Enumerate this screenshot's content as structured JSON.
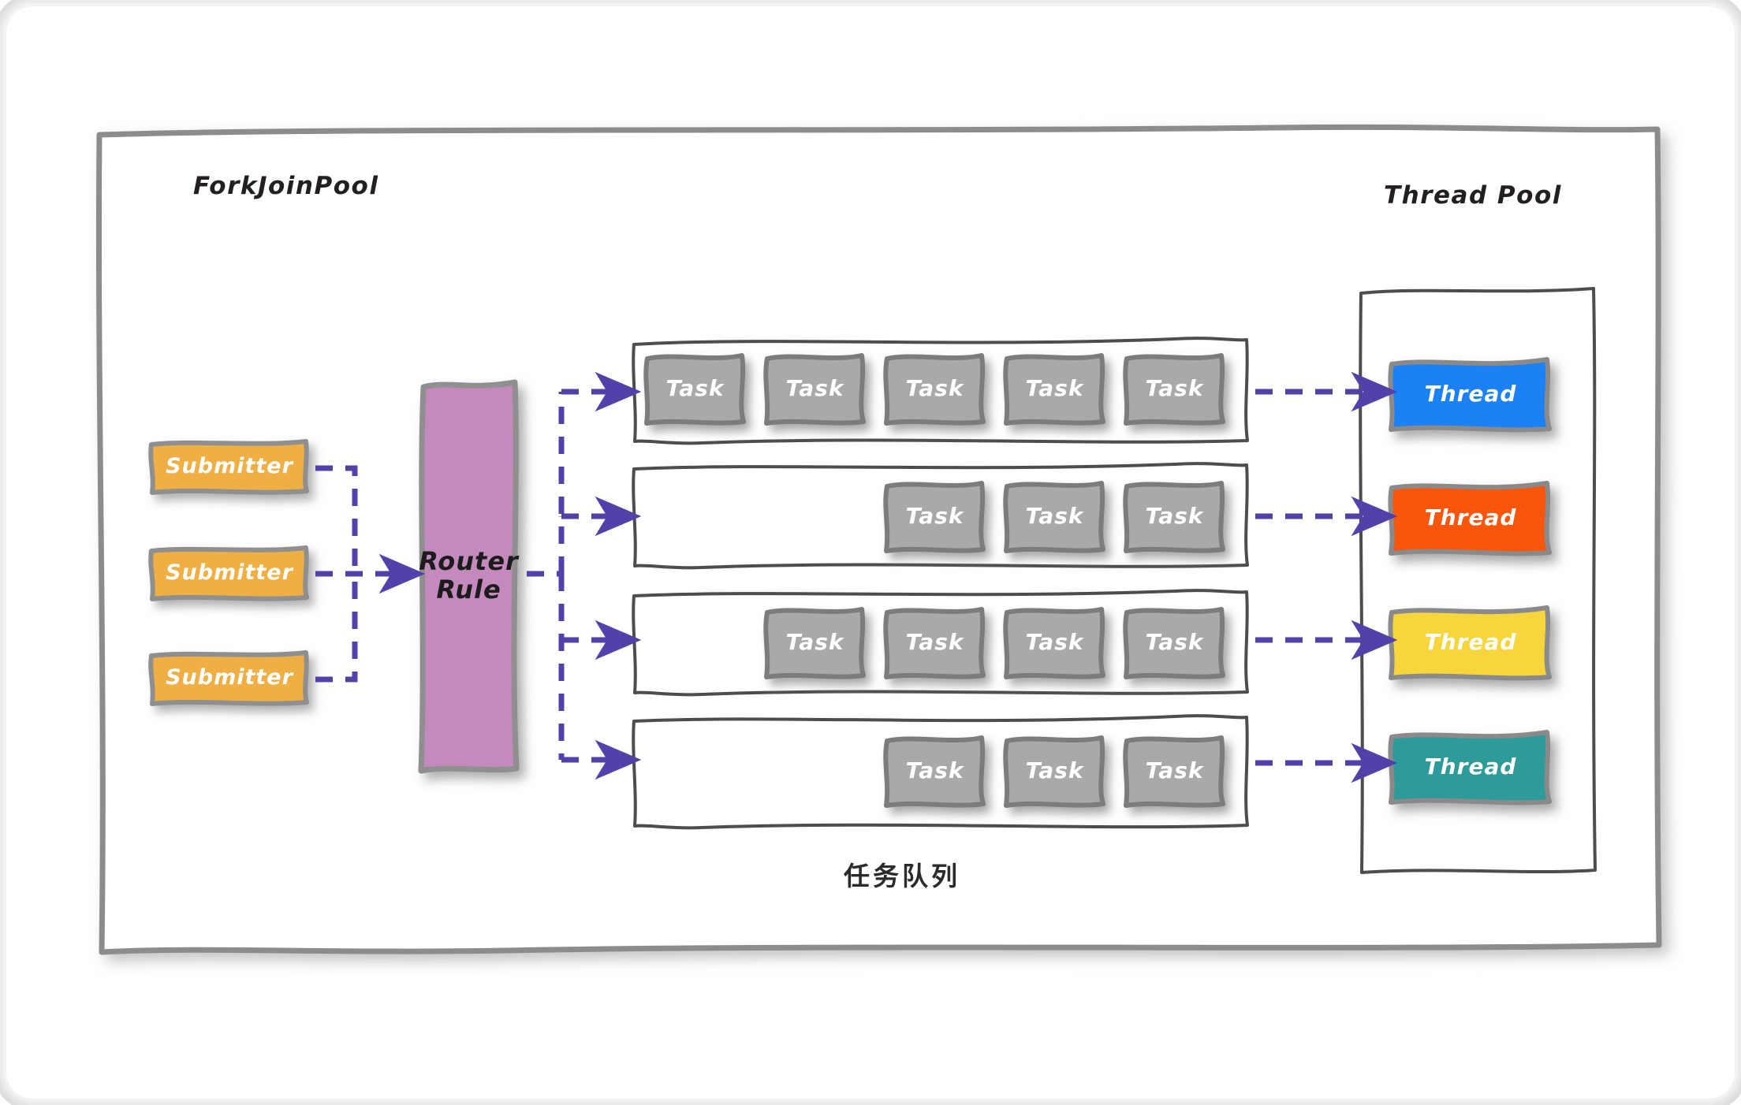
{
  "diagram": {
    "fork_join_pool_label": "ForkJoinPool",
    "thread_pool_label": "Thread Pool",
    "queue_caption": "任务队列",
    "router": {
      "line1": "Router",
      "line2": "Rule"
    },
    "submitters": [
      {
        "label": "Submitter"
      },
      {
        "label": "Submitter"
      },
      {
        "label": "Submitter"
      }
    ],
    "queues": [
      {
        "align": "left",
        "tasks": [
          "Task",
          "Task",
          "Task",
          "Task",
          "Task"
        ]
      },
      {
        "align": "right",
        "tasks": [
          "Task",
          "Task",
          "Task"
        ]
      },
      {
        "align": "right",
        "tasks": [
          "Task",
          "Task",
          "Task",
          "Task"
        ]
      },
      {
        "align": "right",
        "tasks": [
          "Task",
          "Task",
          "Task"
        ]
      }
    ],
    "threads": [
      {
        "label": "Thread",
        "color": "#1f81f5"
      },
      {
        "label": "Thread",
        "color": "#f85710"
      },
      {
        "label": "Thread",
        "color": "#f7d63c"
      },
      {
        "label": "Thread",
        "color": "#2d9a99"
      }
    ],
    "colors": {
      "submitter_fill": "#efaf45",
      "submitter_stroke": "#8f8f8f",
      "router_fill": "#c489bd",
      "router_stroke": "#8f8f8f",
      "task_fill": "#a9a9a9",
      "task_stroke": "#7b7b7b",
      "thread_stroke": "#8a8a8a",
      "container_stroke": "#4d4d4d",
      "fjp_stroke": "#8c8c8c",
      "arrow": "#5340a8",
      "page_bg": "#ffffff",
      "text_dark": "#231f20",
      "text_light": "#ffffff"
    }
  }
}
